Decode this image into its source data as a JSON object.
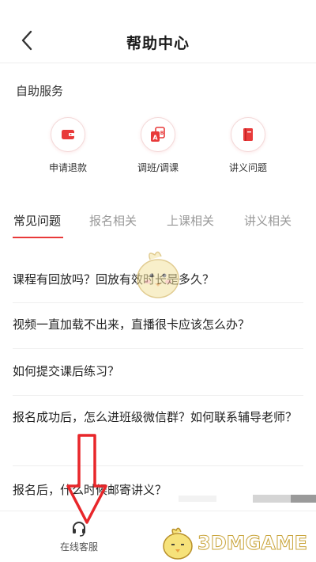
{
  "header": {
    "title": "帮助中心",
    "back_icon": "chevron-left-icon"
  },
  "self_service": {
    "title": "自助服务",
    "items": [
      {
        "label": "申请退款",
        "icon": "wallet-icon"
      },
      {
        "label": "调班/调课",
        "icon": "swap-class-icon"
      },
      {
        "label": "讲义问题",
        "icon": "book-icon"
      }
    ]
  },
  "tabs": [
    {
      "label": "常见问题",
      "active": true
    },
    {
      "label": "报名相关",
      "active": false
    },
    {
      "label": "上课相关",
      "active": false
    },
    {
      "label": "讲义相关",
      "active": false
    }
  ],
  "faq": [
    "课程有回放吗？回放有效时长是多久？",
    "视频一直加载不出来，直播很卡应该怎么办？",
    "如何提交课后练习？",
    "报名成功后，怎么进班级微信群？如何联系辅导老师？",
    "报名后，什么时候邮寄讲义？"
  ],
  "bottom_bar": {
    "customer_service_label": "在线客服",
    "icon": "headset-icon"
  },
  "watermark": {
    "text": "3DMGAME"
  },
  "colors": {
    "accent": "#e83a3a",
    "annotation_arrow": "#e8262a",
    "text_primary": "#222222",
    "text_muted": "#999999"
  }
}
